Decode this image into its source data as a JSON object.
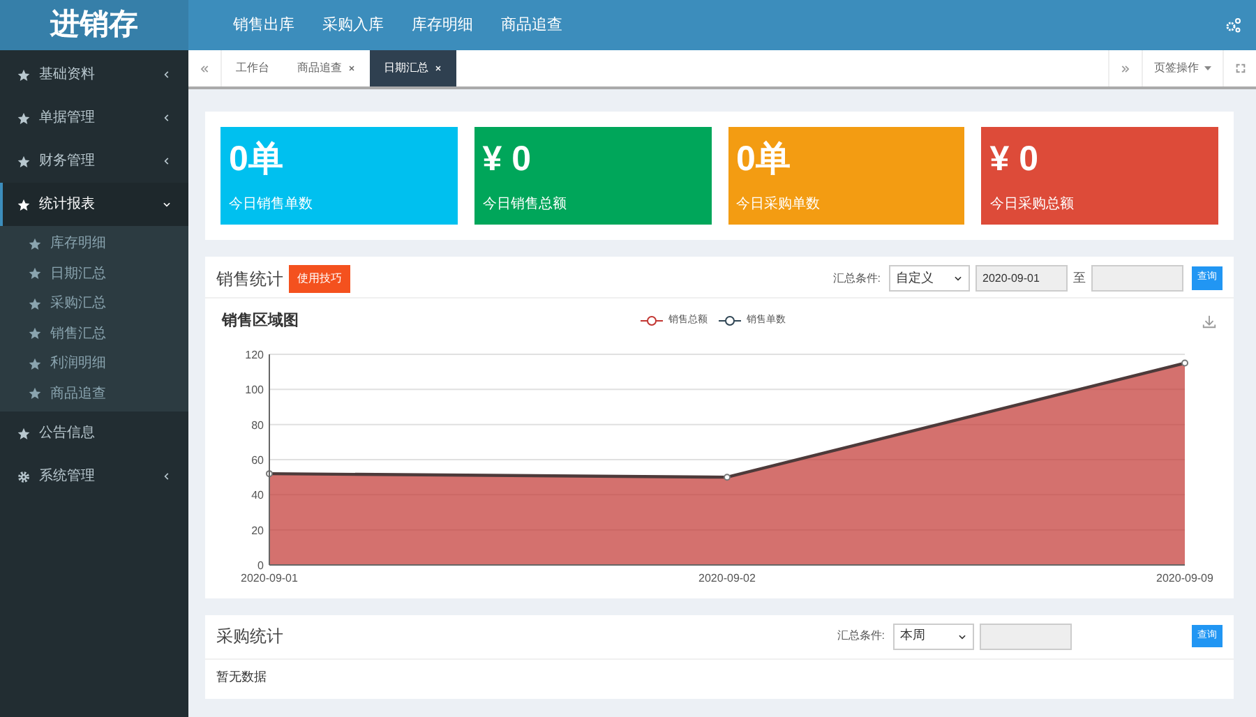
{
  "logo": "进销存",
  "top_nav": [
    {
      "label": "销售出库"
    },
    {
      "label": "采购入库"
    },
    {
      "label": "库存明细"
    },
    {
      "label": "商品追查"
    }
  ],
  "sidebar": {
    "items": [
      {
        "label": "基础资料",
        "kind": "star",
        "expanded": false,
        "selected": false,
        "has_children": true
      },
      {
        "label": "单据管理",
        "kind": "star",
        "expanded": false,
        "selected": false,
        "has_children": true
      },
      {
        "label": "财务管理",
        "kind": "star",
        "expanded": false,
        "selected": false,
        "has_children": true
      },
      {
        "label": "统计报表",
        "kind": "star",
        "expanded": true,
        "selected": true,
        "has_children": true,
        "children": [
          {
            "label": "库存明细"
          },
          {
            "label": "日期汇总"
          },
          {
            "label": "采购汇总"
          },
          {
            "label": "销售汇总"
          },
          {
            "label": "利润明细"
          },
          {
            "label": "商品追查"
          }
        ]
      },
      {
        "label": "公告信息",
        "kind": "star",
        "expanded": false,
        "selected": false,
        "has_children": false
      },
      {
        "label": "系统管理",
        "kind": "gear",
        "expanded": false,
        "selected": false,
        "has_children": true
      }
    ]
  },
  "tabs": [
    {
      "label": "工作台",
      "closable": false,
      "selected": false
    },
    {
      "label": "商品追查",
      "closable": true,
      "selected": false
    },
    {
      "label": "日期汇总",
      "closable": true,
      "selected": true
    }
  ],
  "tab_actions": {
    "label": "页签操作"
  },
  "stat_cards": [
    {
      "value": "0单",
      "label": "今日销售单数",
      "color": "#00c0ef"
    },
    {
      "value": "¥ 0",
      "label": "今日销售总额",
      "color": "#00a65a"
    },
    {
      "value": "0单",
      "label": "今日采购单数",
      "color": "#f39c12"
    },
    {
      "value": "¥ 0",
      "label": "今日采购总额",
      "color": "#dd4b39"
    }
  ],
  "sales_panel": {
    "title": "销售统计",
    "tips_button": "使用技巧",
    "filter_label": "汇总条件:",
    "filter_value": "自定义",
    "date_from": "2020-09-01",
    "date_sep": "至",
    "query_button": "查询",
    "chart_data": {
      "type": "area",
      "title": "销售区域图",
      "categories": [
        "2020-09-01",
        "2020-09-02",
        "2020-09-09"
      ],
      "series": [
        {
          "name": "销售总额",
          "color": "#c23531",
          "values": [
            52,
            50,
            115
          ]
        },
        {
          "name": "销售单数",
          "color": "#2f4554",
          "values": [
            null,
            null,
            null
          ]
        }
      ],
      "grid": true,
      "ylim": [
        0,
        120
      ],
      "yticks": [
        0,
        20,
        40,
        60,
        80,
        100,
        120
      ]
    }
  },
  "purchase_panel": {
    "title": "采购统计",
    "filter_label": "汇总条件:",
    "filter_value": "本周",
    "query_button": "查询",
    "empty_text": "暂无数据"
  }
}
